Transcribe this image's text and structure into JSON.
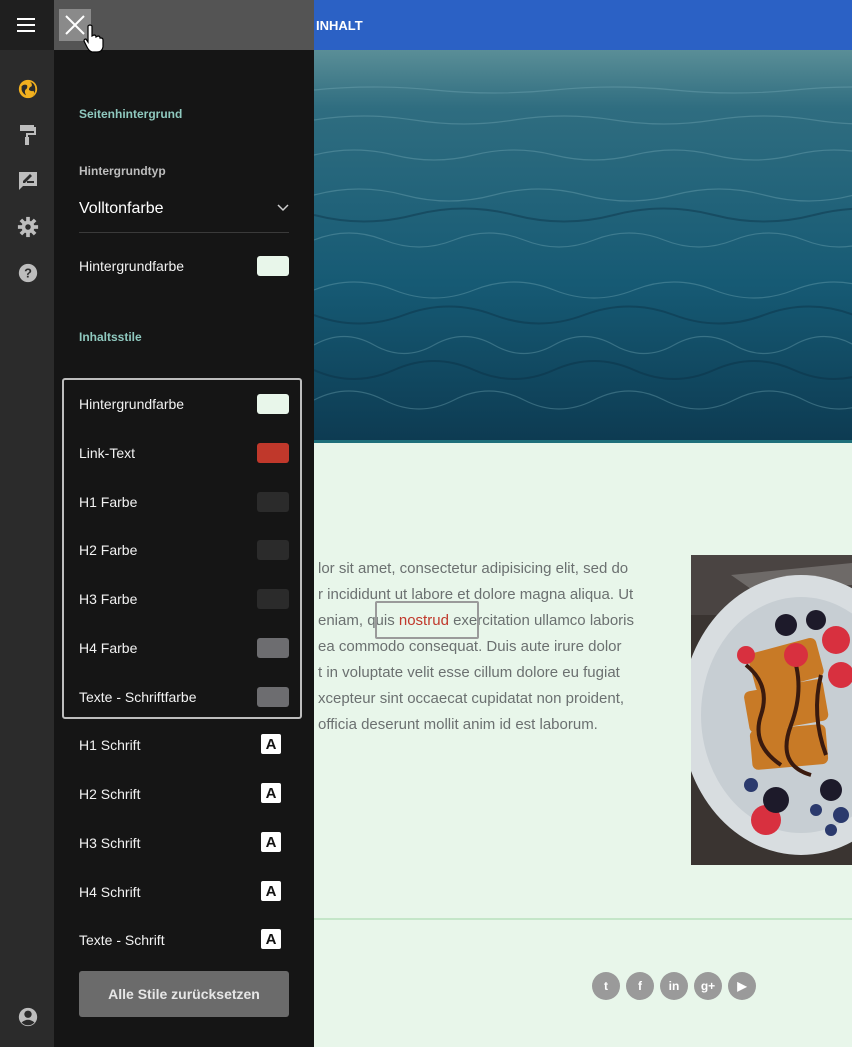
{
  "nav": {
    "content_label": "INHALT"
  },
  "panel": {
    "section_background": "Seitenhintergrund",
    "background_type_label": "Hintergrundtyp",
    "background_type_value": "Volltonfarbe",
    "page_background_color_label": "Hintergrundfarbe",
    "section_content_styles": "Inhaltsstile",
    "color_rows": [
      {
        "label": "Hintergrundfarbe",
        "color": "#e8f6ea"
      },
      {
        "label": "Link-Text",
        "color": "#c0382b"
      },
      {
        "label": "H1 Farbe",
        "color": "#2b2b2b"
      },
      {
        "label": "H2 Farbe",
        "color": "#2b2b2b"
      },
      {
        "label": "H3 Farbe",
        "color": "#2b2b2b"
      },
      {
        "label": "H4 Farbe",
        "color": "#6d6d70"
      },
      {
        "label": "Texte - Schriftfarbe",
        "color": "#6d6d70"
      }
    ],
    "font_rows": [
      {
        "label": "H1 Schrift",
        "icon": "A"
      },
      {
        "label": "H2 Schrift",
        "icon": "A"
      },
      {
        "label": "H3 Schrift",
        "icon": "A"
      },
      {
        "label": "H4 Schrift",
        "icon": "A"
      },
      {
        "label": "Texte - Schrift",
        "icon": "A"
      }
    ],
    "reset_button": "Alle Stile zurücksetzen"
  },
  "rail_icons": [
    "menu-icon",
    "globe-icon",
    "paint-roller-icon",
    "edit-comment-icon",
    "gear-icon",
    "help-icon",
    "account-icon"
  ],
  "content": {
    "paragraph_lines": [
      "lor sit amet, consectetur adipisicing elit, sed do",
      "r incididunt ut labore et dolore magna aliqua. Ut",
      "eniam, quis ",
      "ea commodo consequat. Duis aute irure dolor",
      "t in voluptate velit esse cillum dolore eu fugiat",
      "xcepteur sint occaecat cupidatat non proident,",
      " officia deserunt mollit anim id est laborum."
    ],
    "link_word": "nostrud",
    "line3_after": " exercitation ullamco laboris"
  },
  "social": [
    "t",
    "f",
    "in",
    "g+",
    "▶"
  ],
  "colors": {
    "accent_blue": "#2b61c5",
    "panel_bg": "#151515",
    "rail_bg": "#2b2b2b",
    "page_bg": "#e8f6ea",
    "section_title": "#8fc9bf",
    "rail_active": "#f2b01e"
  }
}
